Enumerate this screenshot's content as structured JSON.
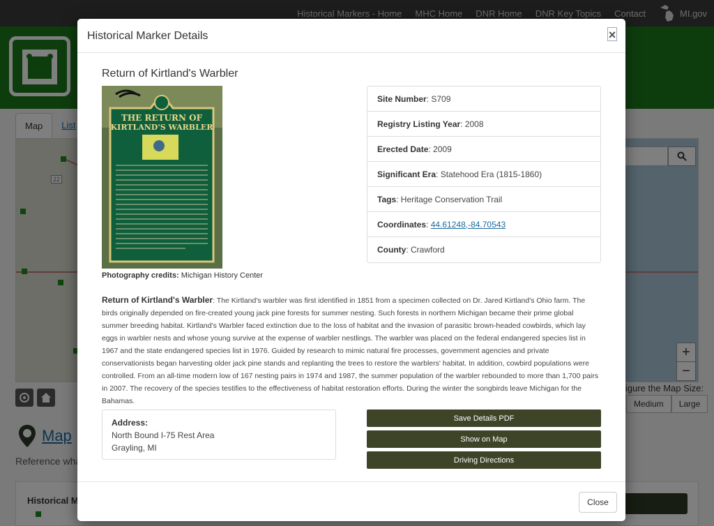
{
  "topnav": {
    "links": [
      "Historical Markers - Home",
      "MHC Home",
      "DNR Home",
      "DNR Key Topics",
      "Contact"
    ],
    "mi_gov": "MI.gov",
    "mi_icon": "michigan-map-icon"
  },
  "page": {
    "tabs": [
      "Map",
      "List"
    ],
    "map_size_label": "igure the Map Size:",
    "size_buttons": [
      "Medium",
      "Large"
    ],
    "zoom_in": "+",
    "zoom_out": "−",
    "map_heading": "Map",
    "reference_text": "Reference wha",
    "bottom_panel_label": "Historical Ma",
    "route_number": "22"
  },
  "modal": {
    "title": "Historical Marker Details",
    "close_x": "×",
    "marker_title": "Return of Kirtland's Warbler",
    "photo": {
      "sign_title_line1": "THE RETURN OF",
      "sign_title_line2": "KIRTLAND'S WARBLER"
    },
    "credits_label": "Photography credits:",
    "credits_value": "Michigan History Center",
    "details": {
      "site_number_label": "Site Number",
      "site_number_value": "S709",
      "registry_year_label": "Registry Listing Year",
      "registry_year_value": "2008",
      "erected_label": "Erected Date",
      "erected_value": "2009",
      "era_label": "Significant Era",
      "era_value": "Statehood Era (1815-1860)",
      "tags_label": "Tags",
      "tags_value": "Heritage Conservation Trail",
      "coords_label": "Coordinates",
      "coords_value": "44.61248,-84.70543",
      "county_label": "County",
      "county_value": "Crawford"
    },
    "description_title": "Return of Kirtland's Warbler",
    "description_text": "The Kirtland's warbler was first identified in 1851 from a specimen collected on Dr. Jared Kirtland's Ohio farm. The birds originally depended on fire-created young jack pine forests for summer nesting. Such forests in northern Michigan became their prime global summer breeding habitat. Kirtland's Warbler faced extinction due to the loss of habitat and the invasion of parasitic brown-headed cowbirds, which lay eggs in warbler nests and whose young survive at the expense of warbler nestlings. The warbler was placed on the federal endangered species list in 1967 and the state endangered species list in 1976. Guided by research to mimic natural fire processes, government agencies and private conservationists began harvesting older jack pine stands and replanting the trees to restore the warblers' habitat. In addition, cowbird populations were controlled. From an all-time modern low of 167 nesting pairs in 1974 and 1987, the summer population of the warbler rebounded to more than 1,700 pairs in 2007. The recovery of the species testifies to the effectiveness of habitat restoration efforts. During the winter the songbirds leave Michigan for the Bahamas.",
    "address": {
      "label": "Address:",
      "line1": "North Bound I-75 Rest Area",
      "line2": "Grayling, MI"
    },
    "buttons": {
      "save_pdf": "Save Details PDF",
      "show_map": "Show on Map",
      "directions": "Driving Directions"
    },
    "footer_close": "Close"
  },
  "colors": {
    "nav_bg": "#3a3a3a",
    "banner_green": "#1d7a1a",
    "action_button": "#3d4428",
    "link_blue": "#1d6a9e"
  }
}
